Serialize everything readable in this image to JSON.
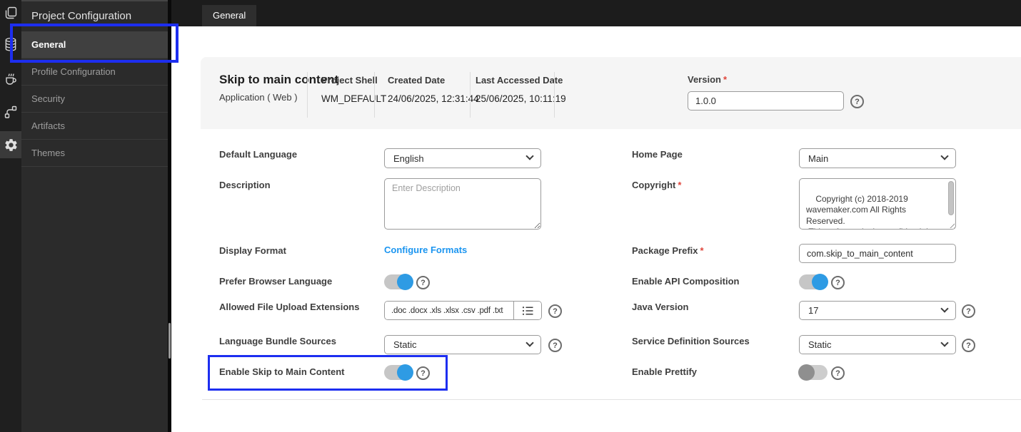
{
  "colors": {
    "annotation_blue": "#1d2ef0",
    "link_blue": "#1b95f0",
    "toggle_on_blue": "#2e9be4",
    "required_red": "#e0443a",
    "sidebar_bg": "#2b2b2b",
    "topbar_bg": "#1c1c1c",
    "header_band_bg": "#f5f5f5"
  },
  "sidebar": {
    "title": "Project Configuration",
    "items": [
      {
        "label": "General",
        "selected": true
      },
      {
        "label": "Profile Configuration"
      },
      {
        "label": "Security"
      },
      {
        "label": "Artifacts"
      },
      {
        "label": "Themes"
      }
    ],
    "rail_icons": [
      "pages-icon",
      "database-icon",
      "java-coffee-icon",
      "workflow-icon",
      "settings-gear-icon"
    ]
  },
  "topbar": {
    "active_tab": "General"
  },
  "header": {
    "title": "Skip to main content",
    "subtitle": "Application ( Web )",
    "meta": [
      {
        "label": "Project Shell",
        "value": "WM_DEFAULT"
      },
      {
        "label": "Created Date",
        "value": "24/06/2025, 12:31:44"
      },
      {
        "label": "Last Accessed Date",
        "value": "25/06/2025, 10:11:19"
      }
    ],
    "version": {
      "label": "Version",
      "required": "*",
      "value": "1.0.0"
    }
  },
  "form": {
    "left": {
      "default_language": {
        "label": "Default Language",
        "value": "English"
      },
      "description": {
        "label": "Description",
        "placeholder": "Enter Description"
      },
      "display_format": {
        "label": "Display Format",
        "link": "Configure Formats"
      },
      "prefer_browser_language": {
        "label": "Prefer Browser Language",
        "state": "on"
      },
      "allowed_file_upload_extensions": {
        "label": "Allowed File Upload Extensions",
        "value": ".doc .docx .xls .xlsx .csv .pdf .txt"
      },
      "language_bundle_sources": {
        "label": "Language Bundle Sources",
        "value": "Static"
      },
      "enable_skip_to_main_content": {
        "label": "Enable Skip to Main Content",
        "state": "on",
        "highlighted": true
      }
    },
    "right": {
      "home_page": {
        "label": "Home Page",
        "value": "Main"
      },
      "copyright": {
        "label": "Copyright",
        "required": "*",
        "value": "Copyright (c) 2018-2019\nwavemaker.com All Rights Reserved.\n This software is the confidential and\nproprietary information of"
      },
      "package_prefix": {
        "label": "Package Prefix",
        "required": "*",
        "value": "com.skip_to_main_content"
      },
      "enable_api_composition": {
        "label": "Enable API Composition",
        "state": "on"
      },
      "java_version": {
        "label": "Java Version",
        "value": "17"
      },
      "service_definition_sources": {
        "label": "Service Definition Sources",
        "value": "Static"
      },
      "enable_prettify": {
        "label": "Enable Prettify",
        "state": "off"
      }
    }
  }
}
